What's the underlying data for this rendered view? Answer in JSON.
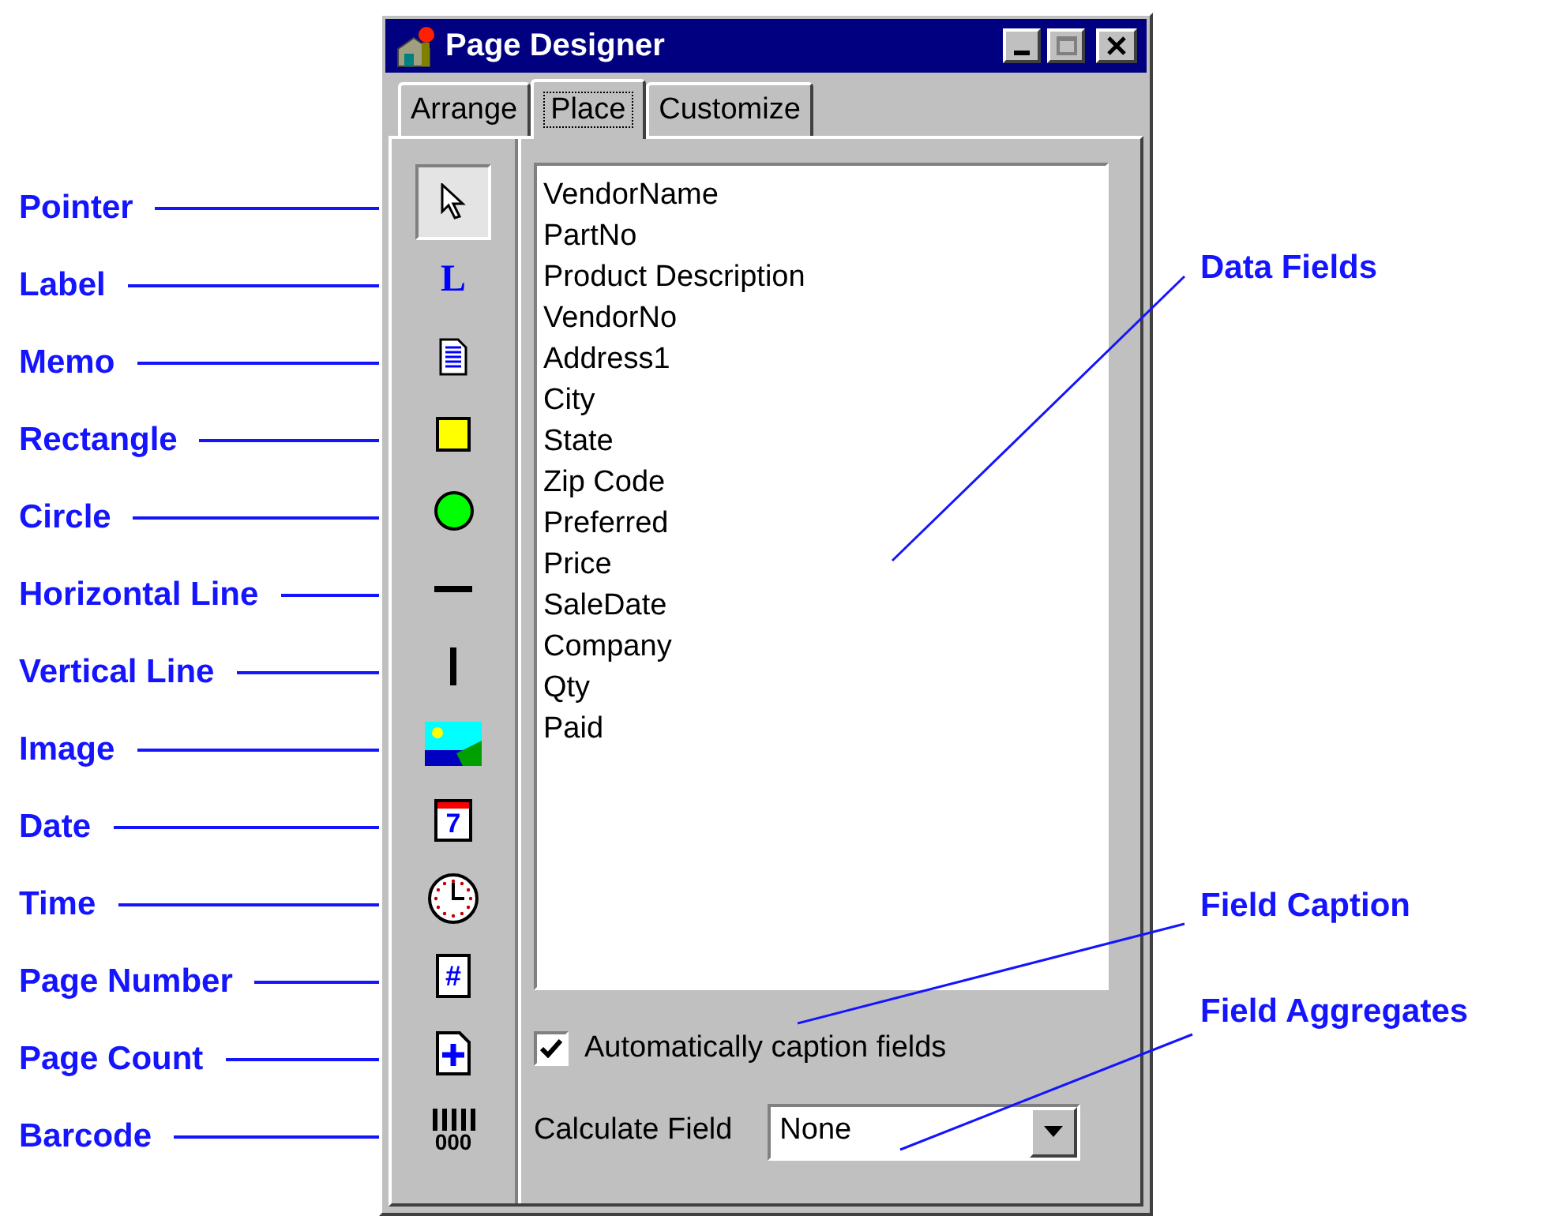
{
  "window": {
    "title": "Page Designer"
  },
  "tabs": [
    {
      "label": "Arrange",
      "selected": false
    },
    {
      "label": "Place",
      "selected": true
    },
    {
      "label": "Customize",
      "selected": false
    }
  ],
  "tools": [
    {
      "label": "Pointer",
      "kind": "pointer",
      "selected": true
    },
    {
      "label": "Label",
      "kind": "label",
      "glyph": "L",
      "selected": false
    },
    {
      "label": "Memo",
      "kind": "memo",
      "selected": false
    },
    {
      "label": "Rectangle",
      "kind": "rectangle",
      "selected": false
    },
    {
      "label": "Circle",
      "kind": "circle",
      "selected": false
    },
    {
      "label": "Horizontal Line",
      "kind": "hline",
      "selected": false
    },
    {
      "label": "Vertical Line",
      "kind": "vline",
      "selected": false
    },
    {
      "label": "Image",
      "kind": "image",
      "selected": false
    },
    {
      "label": "Date",
      "kind": "date",
      "glyph": "7",
      "selected": false
    },
    {
      "label": "Time",
      "kind": "time",
      "selected": false
    },
    {
      "label": "Page Number",
      "kind": "pagenumber",
      "glyph": "#",
      "selected": false
    },
    {
      "label": "Page Count",
      "kind": "pagecount",
      "selected": false
    },
    {
      "label": "Barcode",
      "kind": "barcode",
      "glyph": "000",
      "selected": false
    }
  ],
  "data_fields": [
    "VendorName",
    "PartNo",
    "Product Description",
    "VendorNo",
    "Address1",
    "City",
    "State",
    "Zip Code",
    "Preferred",
    "Price",
    "SaleDate",
    "Company",
    "Qty",
    "Paid"
  ],
  "caption_checkbox": {
    "label": "Automatically caption fields",
    "checked": true
  },
  "calculate_field": {
    "label": "Calculate Field",
    "value": "None"
  },
  "callouts": [
    {
      "label": "Data Fields"
    },
    {
      "label": "Field Caption"
    },
    {
      "label": "Field Aggregates"
    }
  ]
}
